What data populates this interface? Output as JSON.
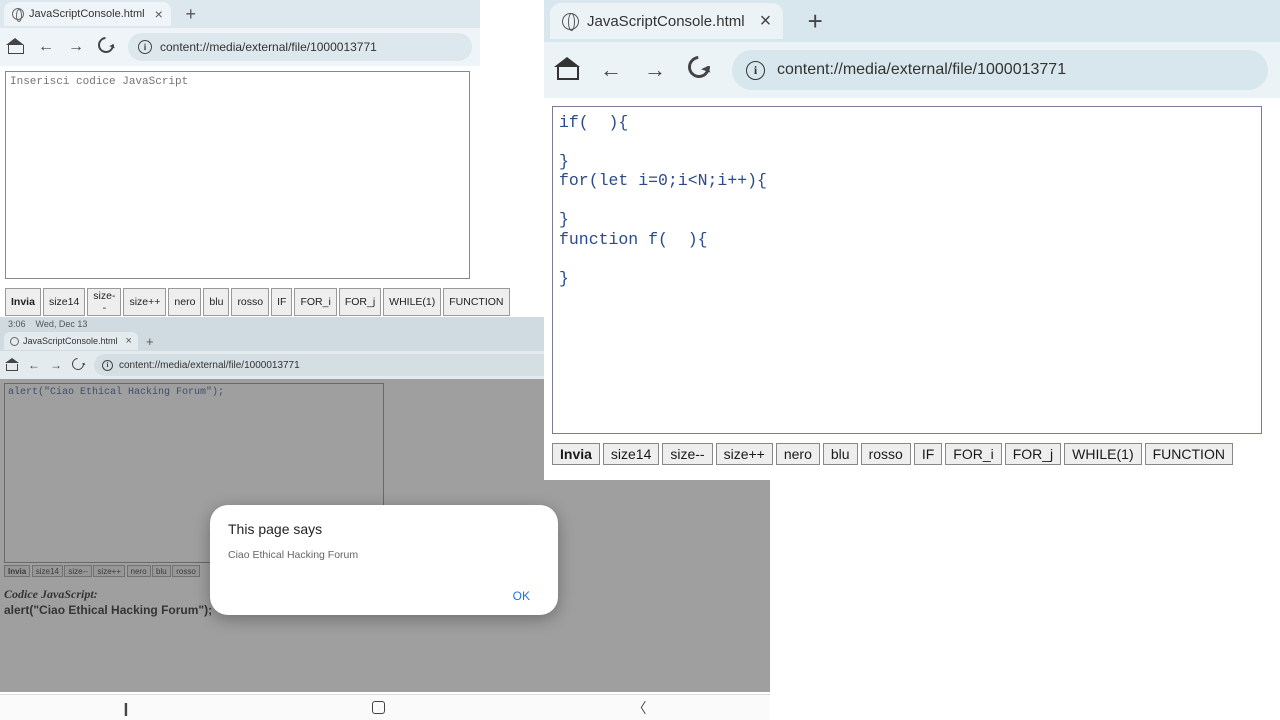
{
  "panel1": {
    "tab_title": "JavaScriptConsole.html",
    "url": "content://media/external/file/1000013771",
    "placeholder": "Inserisci codice JavaScript",
    "buttons": [
      "Invia",
      "size14",
      "size--",
      "size++",
      "nero",
      "blu",
      "rosso",
      "IF",
      "FOR_i",
      "FOR_j",
      "WHILE(1)",
      "FUNCTION"
    ]
  },
  "panel2": {
    "status_time": "3:06",
    "status_date": "Wed, Dec 13",
    "tab_title": "JavaScriptConsole.html",
    "url": "content://media/external/file/1000013771",
    "code": "alert(\"Ciao Ethical Hacking Forum\");",
    "buttons": [
      "Invia",
      "size14",
      "size--",
      "size++",
      "nero",
      "blu",
      "rosso"
    ],
    "code_label": "Codice JavaScript:",
    "code_value": "alert(\"Ciao Ethical Hacking Forum\");",
    "dialog_title": "This page says",
    "dialog_message": "Ciao Ethical Hacking Forum",
    "dialog_ok": "OK"
  },
  "panel3": {
    "tab_title": "JavaScriptConsole.html",
    "url": "content://media/external/file/1000013771",
    "code": "if(  ){\n\n}\nfor(let i=0;i<N;i++){\n\n}\nfunction f(  ){\n\n}",
    "buttons": [
      "Invia",
      "size14",
      "size--",
      "size++",
      "nero",
      "blu",
      "rosso",
      "IF",
      "FOR_i",
      "FOR_j",
      "WHILE(1)",
      "FUNCTION"
    ]
  }
}
